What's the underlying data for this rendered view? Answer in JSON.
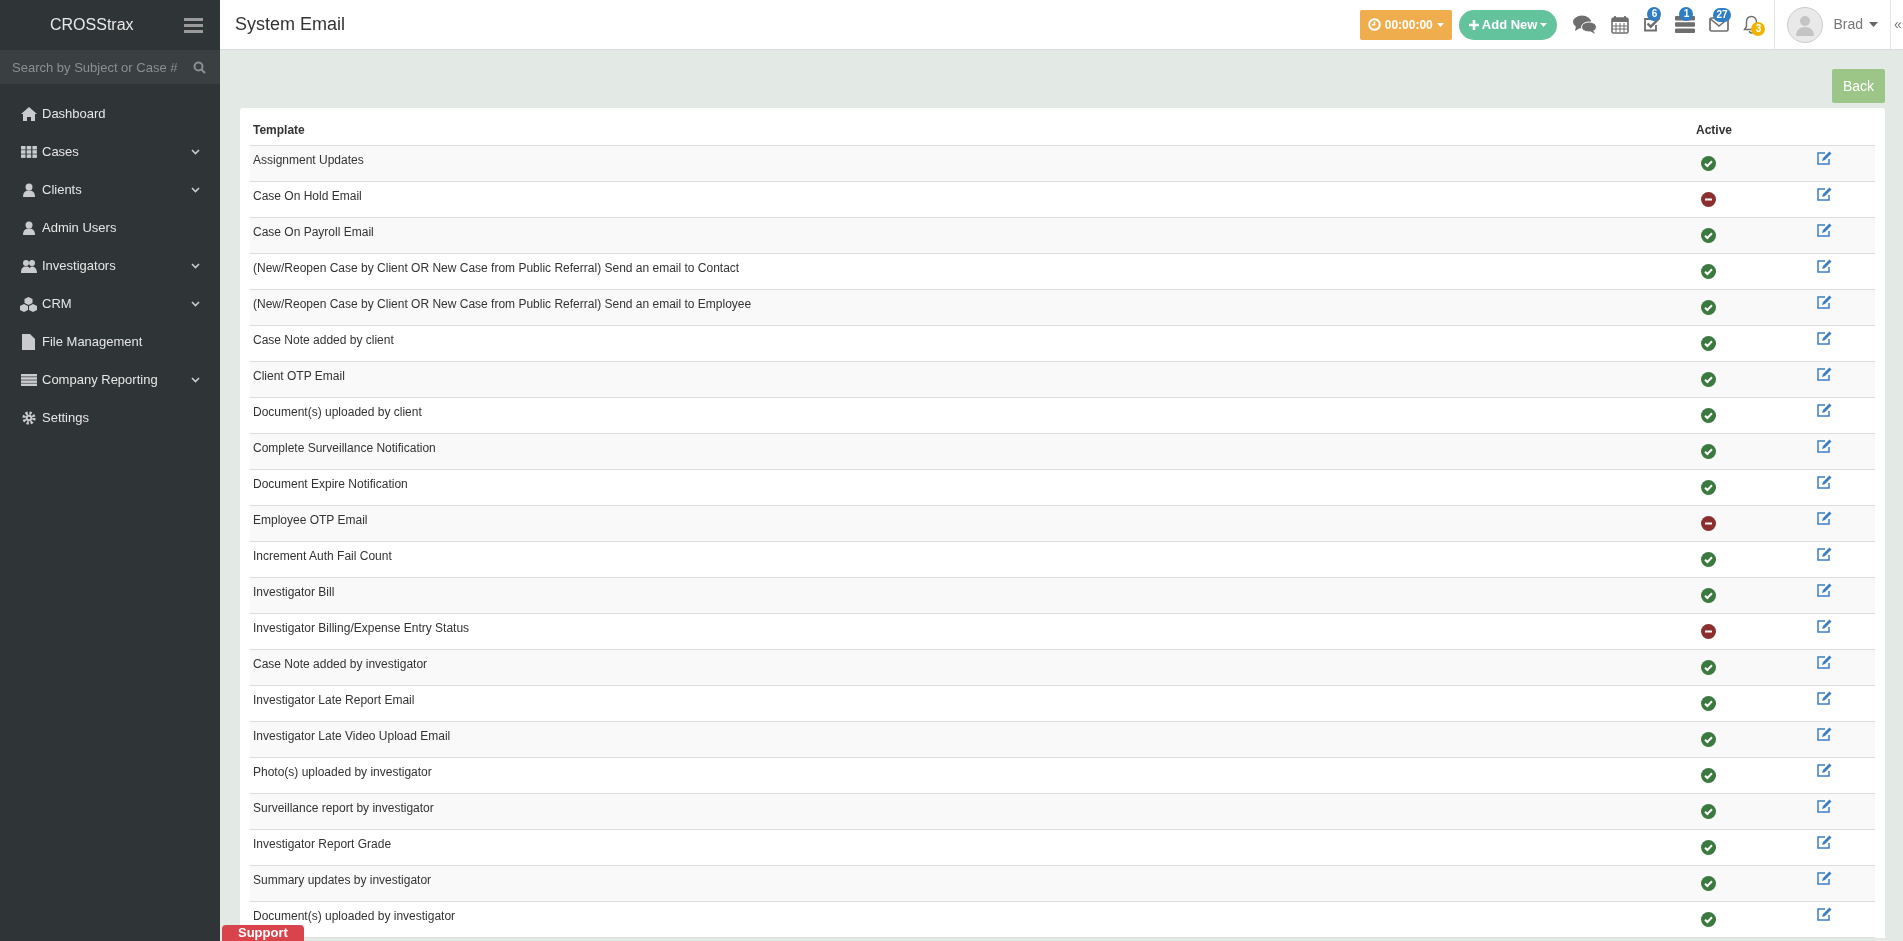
{
  "sidebar": {
    "brand": "CROSStrax",
    "search": {
      "placeholder": "Search by Subject or Case #"
    },
    "items": [
      {
        "label": "Dashboard",
        "expandable": false
      },
      {
        "label": "Cases",
        "expandable": true
      },
      {
        "label": "Clients",
        "expandable": true
      },
      {
        "label": "Admin Users",
        "expandable": false
      },
      {
        "label": "Investigators",
        "expandable": true
      },
      {
        "label": "CRM",
        "expandable": true
      },
      {
        "label": "File Management",
        "expandable": false
      },
      {
        "label": "Company Reporting",
        "expandable": true
      },
      {
        "label": "Settings",
        "expandable": false
      }
    ]
  },
  "header": {
    "title": "System Email",
    "timer": "00:00:00",
    "add_new": "Add New",
    "badges": [
      "6",
      "1",
      "27",
      "3"
    ],
    "user": "Brad",
    "collapse": "«"
  },
  "back_button": "Back",
  "table": {
    "columns": [
      "Template",
      "Active"
    ],
    "rows": [
      {
        "template": "Assignment Updates",
        "active": true
      },
      {
        "template": "Case On Hold Email",
        "active": false
      },
      {
        "template": "Case On Payroll Email",
        "active": true
      },
      {
        "template": "(New/Reopen Case by Client OR New Case from Public Referral) Send an email to Contact",
        "active": true
      },
      {
        "template": "(New/Reopen Case by Client OR New Case from Public Referral) Send an email to Employee",
        "active": true
      },
      {
        "template": "Case Note added by client",
        "active": true
      },
      {
        "template": "Client OTP Email",
        "active": true
      },
      {
        "template": "Document(s) uploaded by client",
        "active": true
      },
      {
        "template": "Complete Surveillance Notification",
        "active": true
      },
      {
        "template": "Document Expire Notification",
        "active": true
      },
      {
        "template": "Employee OTP Email",
        "active": false
      },
      {
        "template": "Increment Auth Fail Count",
        "active": true
      },
      {
        "template": "Investigator Bill",
        "active": true
      },
      {
        "template": "Investigator Billing/Expense Entry Status",
        "active": false
      },
      {
        "template": "Case Note added by investigator",
        "active": true
      },
      {
        "template": "Investigator Late Report Email",
        "active": true
      },
      {
        "template": "Investigator Late Video Upload Email",
        "active": true
      },
      {
        "template": "Photo(s) uploaded by investigator",
        "active": true
      },
      {
        "template": "Surveillance report by investigator",
        "active": true
      },
      {
        "template": "Investigator Report Grade",
        "active": true
      },
      {
        "template": "Summary updates by investigator",
        "active": true
      },
      {
        "template": "Document(s) uploaded by investigator",
        "active": true
      }
    ]
  },
  "support_button": "Support"
}
